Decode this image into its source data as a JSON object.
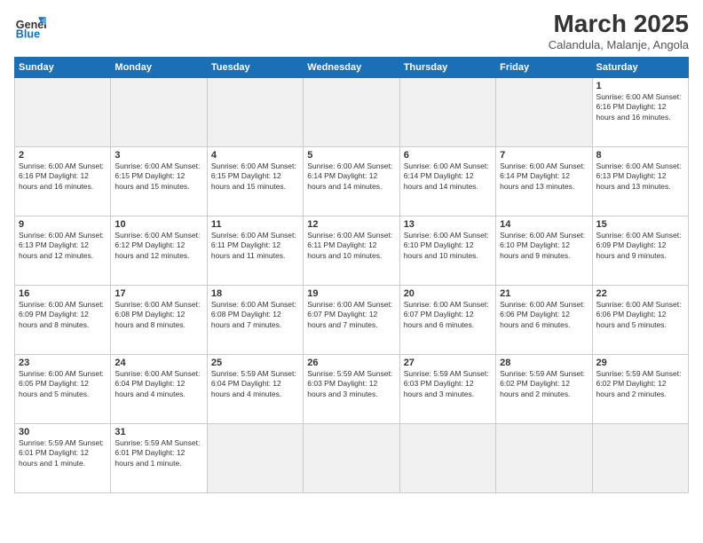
{
  "header": {
    "logo_general": "General",
    "logo_blue": "Blue",
    "title": "March 2025",
    "subtitle": "Calandula, Malanje, Angola"
  },
  "weekdays": [
    "Sunday",
    "Monday",
    "Tuesday",
    "Wednesday",
    "Thursday",
    "Friday",
    "Saturday"
  ],
  "weeks": [
    [
      {
        "day": "",
        "info": "",
        "empty": true
      },
      {
        "day": "",
        "info": "",
        "empty": true
      },
      {
        "day": "",
        "info": "",
        "empty": true
      },
      {
        "day": "",
        "info": "",
        "empty": true
      },
      {
        "day": "",
        "info": "",
        "empty": true
      },
      {
        "day": "",
        "info": "",
        "empty": true
      },
      {
        "day": "1",
        "info": "Sunrise: 6:00 AM\nSunset: 6:16 PM\nDaylight: 12 hours\nand 16 minutes."
      }
    ],
    [
      {
        "day": "2",
        "info": "Sunrise: 6:00 AM\nSunset: 6:16 PM\nDaylight: 12 hours\nand 16 minutes."
      },
      {
        "day": "3",
        "info": "Sunrise: 6:00 AM\nSunset: 6:15 PM\nDaylight: 12 hours\nand 15 minutes."
      },
      {
        "day": "4",
        "info": "Sunrise: 6:00 AM\nSunset: 6:15 PM\nDaylight: 12 hours\nand 15 minutes."
      },
      {
        "day": "5",
        "info": "Sunrise: 6:00 AM\nSunset: 6:14 PM\nDaylight: 12 hours\nand 14 minutes."
      },
      {
        "day": "6",
        "info": "Sunrise: 6:00 AM\nSunset: 6:14 PM\nDaylight: 12 hours\nand 14 minutes."
      },
      {
        "day": "7",
        "info": "Sunrise: 6:00 AM\nSunset: 6:14 PM\nDaylight: 12 hours\nand 13 minutes."
      },
      {
        "day": "8",
        "info": "Sunrise: 6:00 AM\nSunset: 6:13 PM\nDaylight: 12 hours\nand 13 minutes."
      }
    ],
    [
      {
        "day": "9",
        "info": "Sunrise: 6:00 AM\nSunset: 6:13 PM\nDaylight: 12 hours\nand 12 minutes."
      },
      {
        "day": "10",
        "info": "Sunrise: 6:00 AM\nSunset: 6:12 PM\nDaylight: 12 hours\nand 12 minutes."
      },
      {
        "day": "11",
        "info": "Sunrise: 6:00 AM\nSunset: 6:11 PM\nDaylight: 12 hours\nand 11 minutes."
      },
      {
        "day": "12",
        "info": "Sunrise: 6:00 AM\nSunset: 6:11 PM\nDaylight: 12 hours\nand 10 minutes."
      },
      {
        "day": "13",
        "info": "Sunrise: 6:00 AM\nSunset: 6:10 PM\nDaylight: 12 hours\nand 10 minutes."
      },
      {
        "day": "14",
        "info": "Sunrise: 6:00 AM\nSunset: 6:10 PM\nDaylight: 12 hours\nand 9 minutes."
      },
      {
        "day": "15",
        "info": "Sunrise: 6:00 AM\nSunset: 6:09 PM\nDaylight: 12 hours\nand 9 minutes."
      }
    ],
    [
      {
        "day": "16",
        "info": "Sunrise: 6:00 AM\nSunset: 6:09 PM\nDaylight: 12 hours\nand 8 minutes."
      },
      {
        "day": "17",
        "info": "Sunrise: 6:00 AM\nSunset: 6:08 PM\nDaylight: 12 hours\nand 8 minutes."
      },
      {
        "day": "18",
        "info": "Sunrise: 6:00 AM\nSunset: 6:08 PM\nDaylight: 12 hours\nand 7 minutes."
      },
      {
        "day": "19",
        "info": "Sunrise: 6:00 AM\nSunset: 6:07 PM\nDaylight: 12 hours\nand 7 minutes."
      },
      {
        "day": "20",
        "info": "Sunrise: 6:00 AM\nSunset: 6:07 PM\nDaylight: 12 hours\nand 6 minutes."
      },
      {
        "day": "21",
        "info": "Sunrise: 6:00 AM\nSunset: 6:06 PM\nDaylight: 12 hours\nand 6 minutes."
      },
      {
        "day": "22",
        "info": "Sunrise: 6:00 AM\nSunset: 6:06 PM\nDaylight: 12 hours\nand 5 minutes."
      }
    ],
    [
      {
        "day": "23",
        "info": "Sunrise: 6:00 AM\nSunset: 6:05 PM\nDaylight: 12 hours\nand 5 minutes."
      },
      {
        "day": "24",
        "info": "Sunrise: 6:00 AM\nSunset: 6:04 PM\nDaylight: 12 hours\nand 4 minutes."
      },
      {
        "day": "25",
        "info": "Sunrise: 5:59 AM\nSunset: 6:04 PM\nDaylight: 12 hours\nand 4 minutes."
      },
      {
        "day": "26",
        "info": "Sunrise: 5:59 AM\nSunset: 6:03 PM\nDaylight: 12 hours\nand 3 minutes."
      },
      {
        "day": "27",
        "info": "Sunrise: 5:59 AM\nSunset: 6:03 PM\nDaylight: 12 hours\nand 3 minutes."
      },
      {
        "day": "28",
        "info": "Sunrise: 5:59 AM\nSunset: 6:02 PM\nDaylight: 12 hours\nand 2 minutes."
      },
      {
        "day": "29",
        "info": "Sunrise: 5:59 AM\nSunset: 6:02 PM\nDaylight: 12 hours\nand 2 minutes."
      }
    ],
    [
      {
        "day": "30",
        "info": "Sunrise: 5:59 AM\nSunset: 6:01 PM\nDaylight: 12 hours\nand 1 minute."
      },
      {
        "day": "31",
        "info": "Sunrise: 5:59 AM\nSunset: 6:01 PM\nDaylight: 12 hours\nand 1 minute."
      },
      {
        "day": "",
        "info": "",
        "empty": true
      },
      {
        "day": "",
        "info": "",
        "empty": true
      },
      {
        "day": "",
        "info": "",
        "empty": true
      },
      {
        "day": "",
        "info": "",
        "empty": true
      },
      {
        "day": "",
        "info": "",
        "empty": true
      }
    ]
  ]
}
